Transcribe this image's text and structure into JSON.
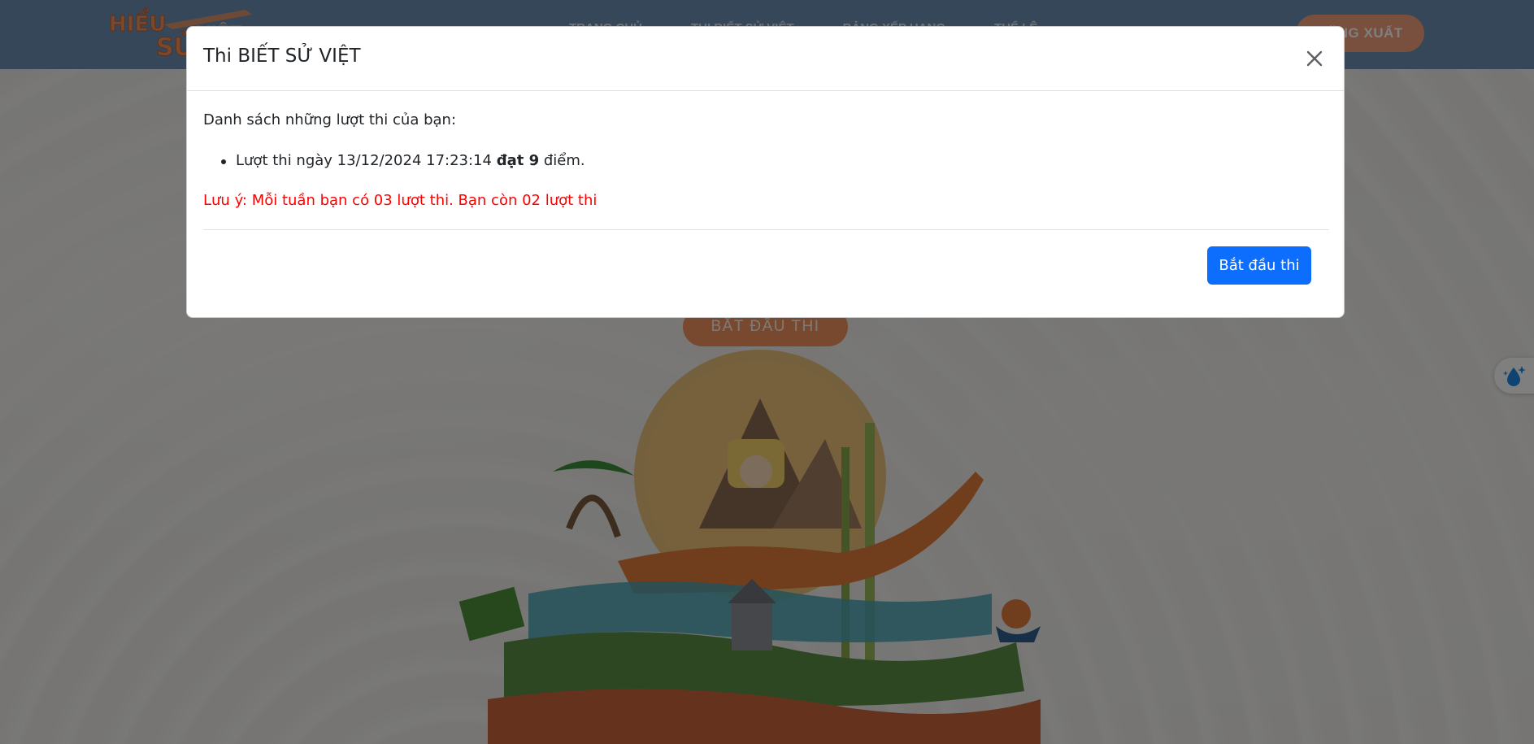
{
  "navbar": {
    "logo_alt": "Hiểu Sử Việt",
    "links": [
      "TRANG CHỦ",
      "THI BIẾT SỬ VIỆT",
      "BẢNG XẾP HẠNG",
      "THỂ LỆ"
    ],
    "logout_label": "ĐĂNG XUẤT"
  },
  "background": {
    "start_button_label": "BẮT ĐẦU THI"
  },
  "modal": {
    "title": "Thi BIẾT SỬ VIỆT",
    "intro": "Danh sách những lượt thi của bạn:",
    "attempts": [
      {
        "prefix": "Lượt thi ngày 13/12/2024 17:23:14",
        "bold": "đạt 9",
        "suffix": "điểm."
      }
    ],
    "notice": "Lưu ý: Mỗi tuần bạn có 03 lượt thi. Bạn còn 02 lượt thi",
    "start_button_label": "Bắt đầu thi"
  },
  "colors": {
    "navbar": "#6d8fb3",
    "accent_orange": "#f0935f",
    "primary_button": "#0d6efd",
    "notice_red": "#ff0000"
  },
  "icons": {
    "close": "close-icon",
    "float_tool": "drop-sparkle-icon"
  }
}
